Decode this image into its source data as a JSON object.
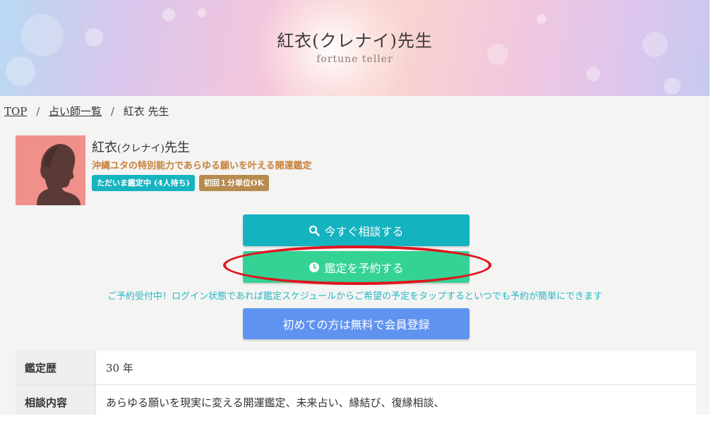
{
  "hero": {
    "title": "紅衣(クレナイ)先生",
    "subtitle": "fortune teller"
  },
  "breadcrumb": {
    "items": [
      "TOP",
      "占い師一覧",
      "紅衣 先生"
    ],
    "separator": "/"
  },
  "profile": {
    "name": "紅衣",
    "kana": "(クレナイ)",
    "suffix": "先生",
    "tagline": "沖縄ユタの特別能力であらゆる願いを叶える開運鑑定",
    "badges": [
      {
        "label": "ただいま鑑定中 (4人待ち)",
        "color": "#17b3bf"
      },
      {
        "label": "初回１分単位OK",
        "color": "#b78b4f"
      }
    ]
  },
  "actions": {
    "consult_label": "今すぐ相談する",
    "reserve_label": "鑑定を予約する",
    "register_label": "初めての方は無料で会員登録",
    "notice": "ご予約受付中！ログイン状態であれば鑑定スケジュールからご希望の予定をタップするといつでも予約が簡単にできます"
  },
  "details": [
    {
      "label": "鑑定歴",
      "value": "30 年"
    },
    {
      "label": "相談内容",
      "value": "あらゆる願いを現実に変える開運鑑定、未来占い、縁結び、復縁相談、"
    }
  ],
  "colors": {
    "teal": "#15b3bf",
    "green": "#35d295",
    "blue": "#6093f0",
    "tagline": "#c8813a",
    "highlight": "#e0141e"
  },
  "icons": {
    "consult": "search-icon",
    "reserve": "clock-icon",
    "avatar": "female-silhouette-icon"
  }
}
